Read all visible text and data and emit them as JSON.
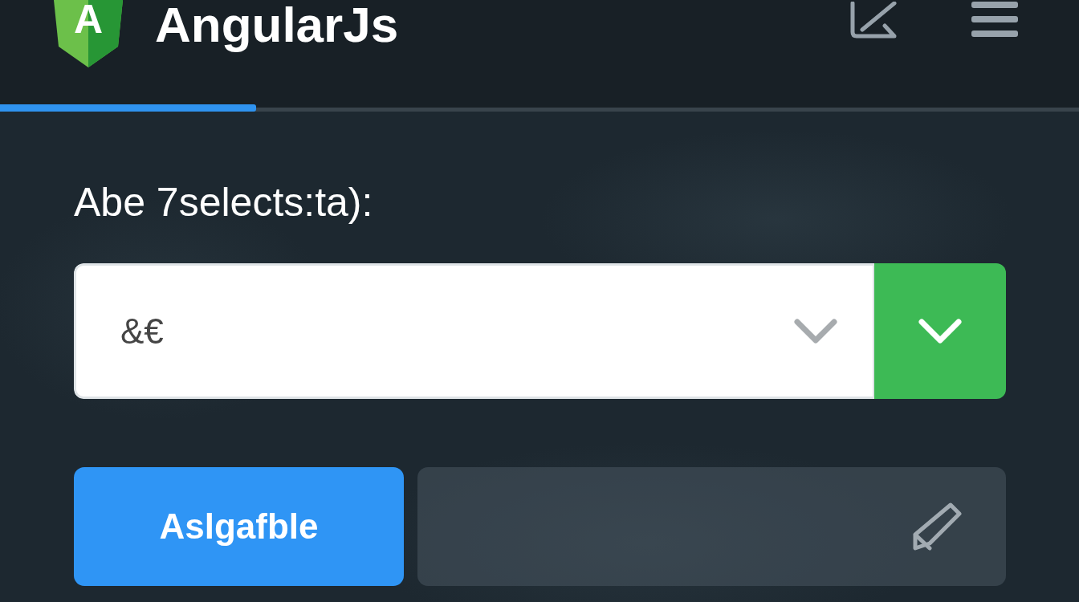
{
  "header": {
    "logo": {
      "letter": "A"
    },
    "title": "AngularJs"
  },
  "progress": {
    "level": 0.237
  },
  "form": {
    "label": "Abe 7selects:ta):",
    "select": {
      "value": "&€"
    },
    "primary_button": {
      "label": "Aslgafble"
    }
  }
}
